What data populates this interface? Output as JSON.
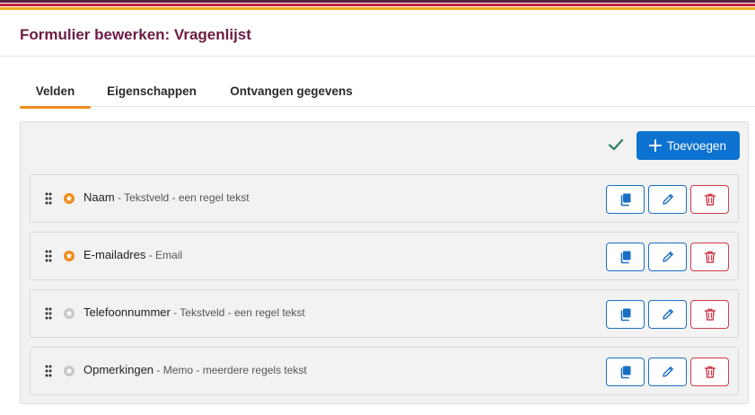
{
  "header": {
    "title": "Formulier bewerken: Vragenlijst"
  },
  "tabs": [
    {
      "label": "Velden",
      "active": true
    },
    {
      "label": "Eigenschappen",
      "active": false
    },
    {
      "label": "Ontvangen gegevens",
      "active": false
    }
  ],
  "toolbar": {
    "add_label": "Toevoegen"
  },
  "colors": {
    "accent": "#0d72d0",
    "tab_underline": "#f08a1a",
    "title": "#6b1d45",
    "required_star": "#f08a1a",
    "optional_star": "#c8c8c8",
    "danger": "#cf3a4a"
  },
  "fields": [
    {
      "name": "Naam",
      "meta": " - Tekstveld - een regel tekst",
      "required": true
    },
    {
      "name": "E-mailadres",
      "meta": " - Email",
      "required": true
    },
    {
      "name": "Telefoonnummer",
      "meta": " - Tekstveld - een regel tekst",
      "required": false
    },
    {
      "name": "Opmerkingen",
      "meta": " - Memo - meerdere regels tekst",
      "required": false
    }
  ]
}
